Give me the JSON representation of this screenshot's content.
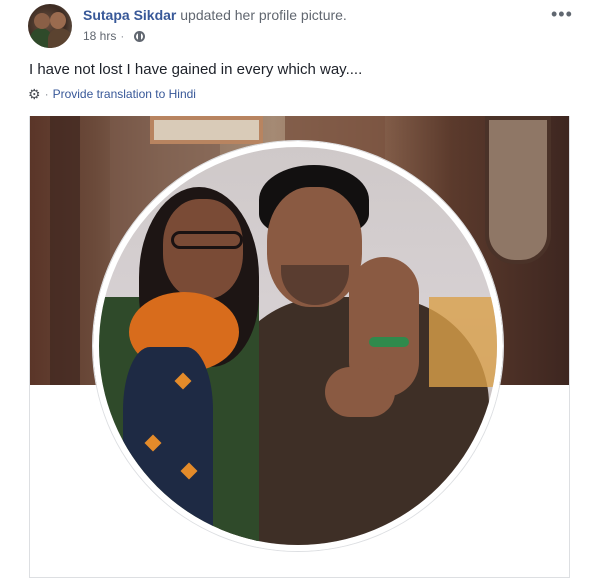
{
  "post": {
    "author": "Sutapa Sikdar",
    "action": "updated her profile picture.",
    "timestamp": "18 hrs",
    "privacy_icon": "globe-icon",
    "more_icon_glyph": "•••",
    "text": "I have not lost I have gained in every which way....",
    "translation_sep": "·",
    "translation_link": "Provide translation to Hindi",
    "colors": {
      "link": "#385898",
      "meta": "#616770",
      "text": "#1d2129",
      "border": "#dddfe2"
    }
  }
}
